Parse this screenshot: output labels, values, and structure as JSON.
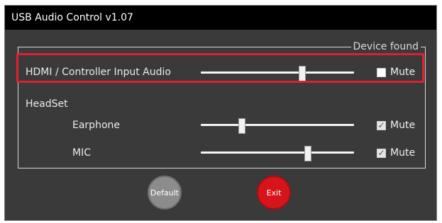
{
  "window": {
    "title": "USB Audio Control v1.07"
  },
  "group": {
    "title": "Device found"
  },
  "rows": [
    {
      "label": "HDMI / Controller Input Audio",
      "level": 0.66,
      "mute_label": "Mute",
      "muted": false
    },
    {
      "label": "HeadSet"
    },
    {
      "label": "Earphone",
      "level": 0.27,
      "mute_label": "Mute",
      "muted": true
    },
    {
      "label": "MIC",
      "level": 0.7,
      "mute_label": "Mute",
      "muted": true
    }
  ],
  "buttons": {
    "default_label": "Default",
    "exit_label": "Exit"
  },
  "colors": {
    "background": "#3a3a3a",
    "titlebar": "#000000",
    "highlight": "#e01f2f",
    "exit_button": "#d8141b",
    "default_button": "#8c8c8c"
  },
  "icons": {
    "checkbox_checked": "check-icon"
  }
}
